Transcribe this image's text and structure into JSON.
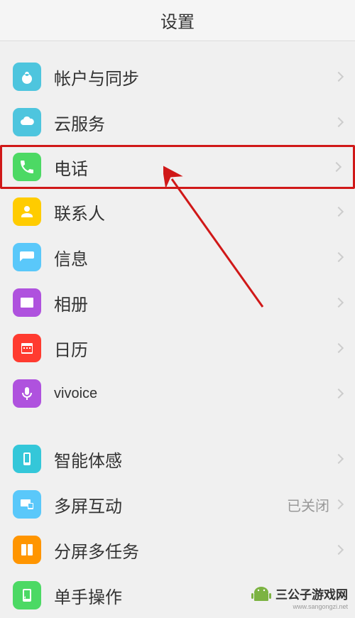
{
  "header": {
    "title": "设置"
  },
  "section1": {
    "items": [
      {
        "label": "帐户与同步",
        "icon": "account-icon",
        "iconClass": "icon-account"
      },
      {
        "label": "云服务",
        "icon": "cloud-icon",
        "iconClass": "icon-cloud"
      },
      {
        "label": "电话",
        "icon": "phone-icon",
        "iconClass": "icon-phone",
        "highlighted": true
      },
      {
        "label": "联系人",
        "icon": "contacts-icon",
        "iconClass": "icon-contacts"
      },
      {
        "label": "信息",
        "icon": "message-icon",
        "iconClass": "icon-message"
      },
      {
        "label": "相册",
        "icon": "album-icon",
        "iconClass": "icon-album"
      },
      {
        "label": "日历",
        "icon": "calendar-icon",
        "iconClass": "icon-calendar"
      },
      {
        "label": "vivoice",
        "icon": "voice-icon",
        "iconClass": "icon-voice"
      }
    ]
  },
  "section2": {
    "items": [
      {
        "label": "智能体感",
        "icon": "smart-icon",
        "iconClass": "icon-smart"
      },
      {
        "label": "多屏互动",
        "icon": "multi-icon",
        "iconClass": "icon-multi",
        "status": "已关闭"
      },
      {
        "label": "分屏多任务",
        "icon": "split-icon",
        "iconClass": "icon-split"
      },
      {
        "label": "单手操作",
        "icon": "hand-icon",
        "iconClass": "icon-hand"
      }
    ]
  },
  "watermark": {
    "text": "三公子游戏网",
    "url": "www.sangongzi.net"
  }
}
